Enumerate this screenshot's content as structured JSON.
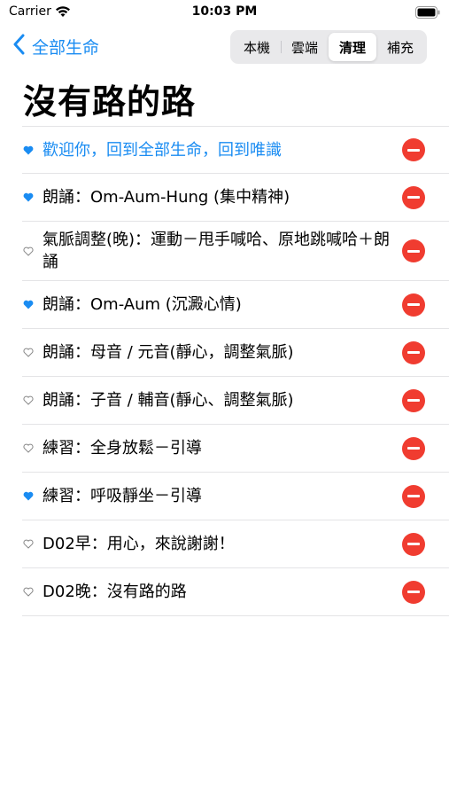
{
  "status_bar": {
    "carrier": "Carrier",
    "time": "10:03 PM"
  },
  "nav": {
    "back_label": "全部生命"
  },
  "segments": [
    {
      "label": "本機",
      "active": false
    },
    {
      "label": "雲端",
      "active": false
    },
    {
      "label": "清理",
      "active": true
    },
    {
      "label": "補充",
      "active": false
    }
  ],
  "title": "沒有路的路",
  "colors": {
    "accent": "#1a8cf2",
    "delete": "#f03c30"
  },
  "rows": [
    {
      "label": "歡迎你，回到全部生命，回到唯識",
      "favorite": true,
      "highlighted": true
    },
    {
      "label": "朗誦：Om-Aum-Hung (集中精神)",
      "favorite": true,
      "highlighted": false
    },
    {
      "label": "氣脈調整(晚)：運動－甩手喊哈、原地跳喊哈＋朗誦",
      "favorite": false,
      "highlighted": false
    },
    {
      "label": "朗誦：Om-Aum (沉澱心情)",
      "favorite": true,
      "highlighted": false
    },
    {
      "label": "朗誦：母音 / 元音(靜心，調整氣脈)",
      "favorite": false,
      "highlighted": false
    },
    {
      "label": "朗誦：子音 / 輔音(靜心、調整氣脈)",
      "favorite": false,
      "highlighted": false
    },
    {
      "label": "練習：全身放鬆－引導",
      "favorite": false,
      "highlighted": false
    },
    {
      "label": "練習：呼吸靜坐－引導",
      "favorite": true,
      "highlighted": false
    },
    {
      "label": "D02早：用心，來說謝謝！",
      "favorite": false,
      "highlighted": false
    },
    {
      "label": "D02晚：沒有路的路",
      "favorite": false,
      "highlighted": false
    }
  ]
}
